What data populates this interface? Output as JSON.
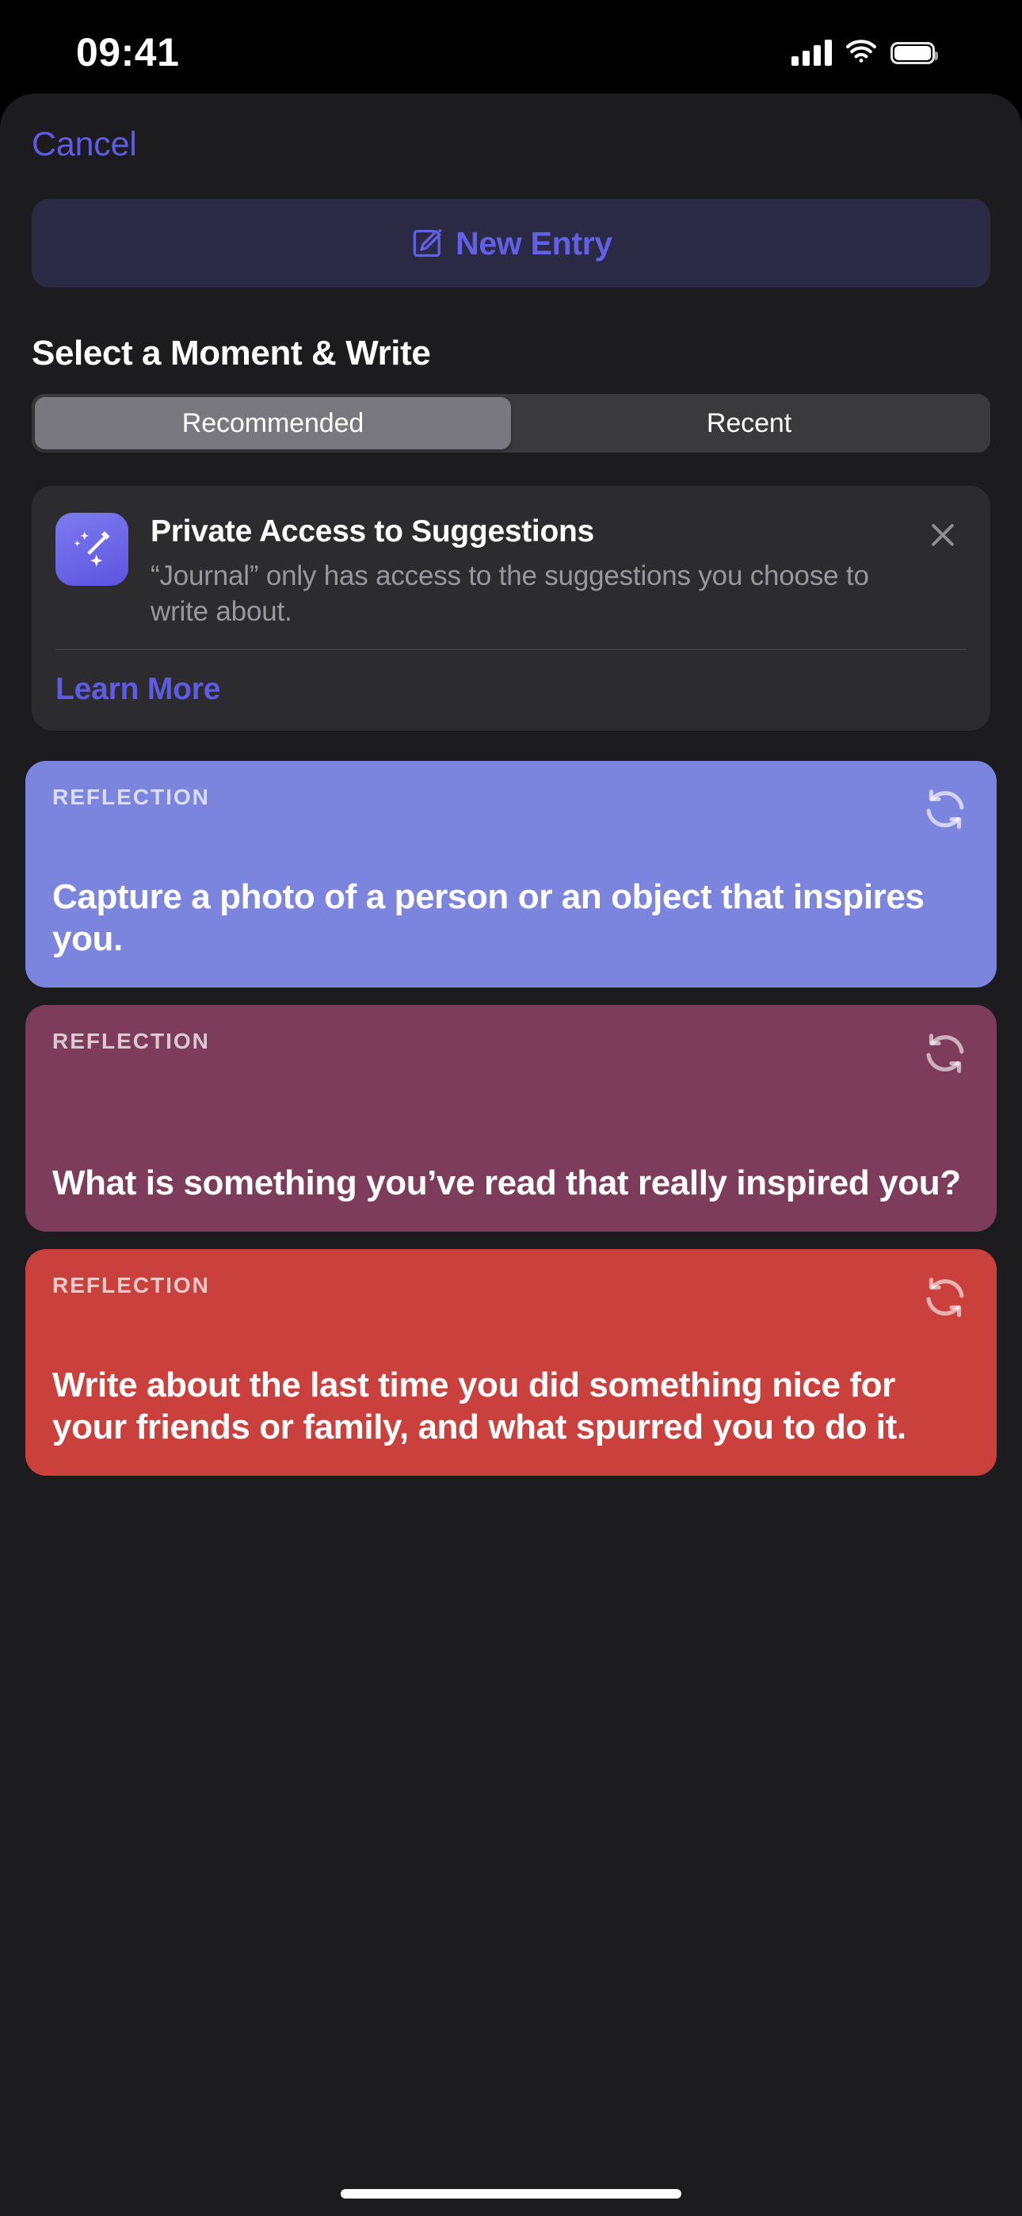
{
  "status_bar": {
    "time": "09:41",
    "cellular_icon": "cellular-bars-icon",
    "wifi_icon": "wifi-icon",
    "battery_icon": "battery-icon"
  },
  "sheet": {
    "cancel_label": "Cancel",
    "new_entry": {
      "label": "New Entry",
      "icon": "square-and-pencil-icon",
      "text_color": "#6360E8",
      "background": "#2A2A45"
    },
    "section_title": "Select a Moment & Write",
    "segmented_control": {
      "options": [
        "Recommended",
        "Recent"
      ],
      "selected_index": 0,
      "selected_background": "#78787E",
      "track_background": "#3A3A3C"
    },
    "notice": {
      "icon": "magic-wand-sparkles-icon",
      "title": "Private Access to Suggestions",
      "body": "“Journal” only has access to the suggestions you choose to write about.",
      "learn_more_label": "Learn More",
      "close_icon": "close-icon",
      "accent_color": "#5E5CE6",
      "background": "#2C2C2E"
    },
    "cards": [
      {
        "kicker": "REFLECTION",
        "prompt": "Capture a photo of a person or an object that inspires you.",
        "color": "#7B85DE",
        "refresh_icon": "refresh-icon"
      },
      {
        "kicker": "REFLECTION",
        "prompt": "What is something you’ve read that really inspired you?",
        "color": "#7D3C5A",
        "refresh_icon": "refresh-icon"
      },
      {
        "kicker": "REFLECTION",
        "prompt": "Write about the last time you did something nice for your friends or family, and what spurred you to do it.",
        "color": "#C9403C",
        "refresh_icon": "refresh-icon"
      }
    ]
  }
}
